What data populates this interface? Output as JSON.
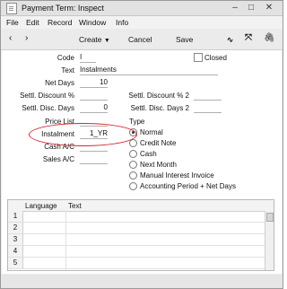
{
  "window": {
    "title": "Payment Term: Inspect"
  },
  "menu": [
    "File",
    "Edit",
    "Record",
    "Window",
    "Info"
  ],
  "toolbar": {
    "create": "Create",
    "cancel": "Cancel",
    "save": "Save"
  },
  "form": {
    "code": {
      "label": "Code",
      "value": "I"
    },
    "closed": {
      "label": "Closed",
      "checked": false
    },
    "text": {
      "label": "Text",
      "value": "Instalments"
    },
    "net_days": {
      "label": "Net Days",
      "value": "10"
    },
    "settl_discount": {
      "label": "Settl. Discount %",
      "value": ""
    },
    "settl_discount2": {
      "label": "Settl. Discount % 2",
      "value": ""
    },
    "settl_disc_days": {
      "label": "Settl. Disc. Days",
      "value": "0"
    },
    "settl_disc_days2": {
      "label": "Settl. Disc. Days 2",
      "value": ""
    },
    "price_list": {
      "label": "Price List",
      "value": ""
    },
    "instalment": {
      "label": "Instalment",
      "value": "1_YR"
    },
    "cash_ac": {
      "label": "Cash A/C",
      "value": ""
    },
    "sales_ac": {
      "label": "Sales A/C",
      "value": ""
    }
  },
  "type": {
    "label": "Type",
    "selected": "Normal",
    "options": [
      "Normal",
      "Credit Note",
      "Cash",
      "Next Month",
      "Manual Interest Invoice",
      "Accounting Period + Net Days"
    ]
  },
  "grid": {
    "headers": [
      "Language",
      "Text"
    ],
    "rows": [
      "1",
      "2",
      "3",
      "4",
      "5"
    ]
  },
  "colors": {
    "highlight": "#d8242a"
  }
}
